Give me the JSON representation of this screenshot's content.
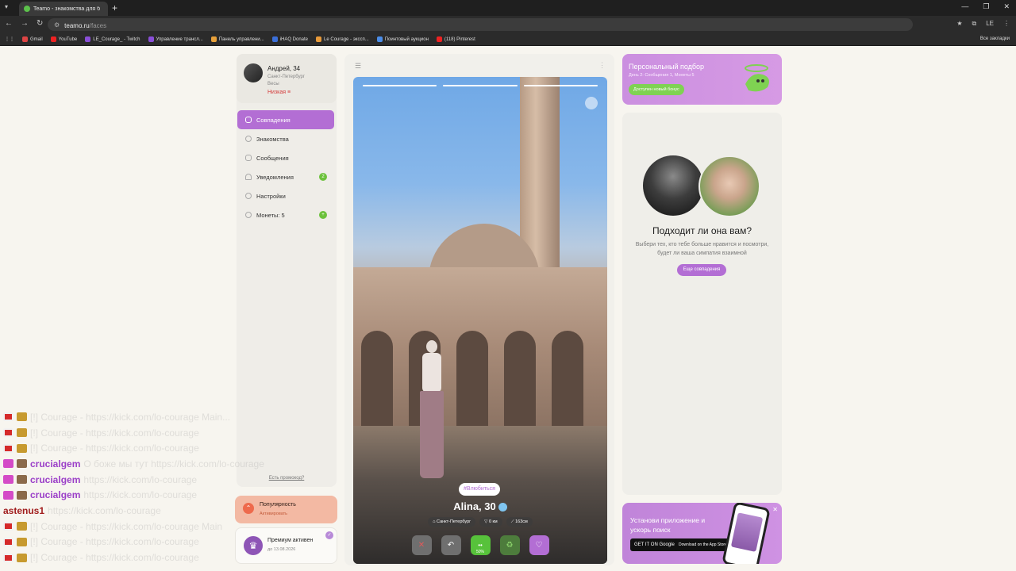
{
  "browser": {
    "tab_title": "Teamo - знакомства для брак...",
    "url_host": "teamo.ru",
    "url_path": "/faces",
    "profile_initials": "LE",
    "bookmarks": [
      "Gmail",
      "YouTube",
      "LE_Courage_ - Twitch",
      "Управление трансл...",
      "Панель управлени...",
      "iHAQ Donate",
      "Le Courage - экссп...",
      "Поинтовый аукцион",
      "(118) Pinterest"
    ],
    "all_bookmarks": "Все закладки"
  },
  "profile": {
    "name": "Андрей, 34",
    "city": "Санкт-Петербург",
    "zodiac": "Весы",
    "level": "Низкая ≡"
  },
  "menu": [
    {
      "label": "Совпадения",
      "icon": "matches-icon",
      "active": true
    },
    {
      "label": "Знакомства",
      "icon": "search-icon",
      "active": false
    },
    {
      "label": "Сообщения",
      "icon": "chat-icon",
      "active": false
    },
    {
      "label": "Уведомления",
      "icon": "bell-icon",
      "active": false,
      "badge": "2"
    },
    {
      "label": "Настройки",
      "icon": "gear-icon",
      "active": false
    },
    {
      "label": "Монеты: 5",
      "icon": "coin-icon",
      "active": false,
      "badge": "+"
    }
  ],
  "promo_link": "Есть промокод?",
  "popularity": {
    "title": "Популярность",
    "subtitle": "Активировать"
  },
  "premium": {
    "title": "Премиум активен",
    "subtitle": "до 13.08.2026"
  },
  "card": {
    "tag": "#Влюбиться",
    "name_age": "Alina, 30",
    "city": "Санкт-Петербург",
    "distance": "0 км",
    "height": "163см",
    "fire_percent": "50%"
  },
  "banner_top": {
    "title": "Персональный подбор",
    "subtitle": "День 2: Сообщения 1, Монеты 5",
    "button": "Доступен новый бонус"
  },
  "match": {
    "question": "Подходит ли она вам?",
    "description": "Выбери тех, кто тебе больше нравится и посмотри, будет ли ваша симпатия взаимной",
    "button": "Еще совпадения"
  },
  "banner_bottom": {
    "title": "Установи приложение и ускорь поиск",
    "google": "GET IT ON Google Play",
    "apple": "Download on the App Store"
  },
  "chat": [
    {
      "badges": [
        "red",
        "gold"
      ],
      "user": "",
      "color": "",
      "message": "[!] Courage - https://kick.com/lo-courage Main..."
    },
    {
      "badges": [
        "red",
        "gold"
      ],
      "user": "",
      "color": "",
      "message": "[!] Courage - https://kick.com/lo-courage"
    },
    {
      "badges": [
        "red",
        "gold"
      ],
      "user": "",
      "color": "",
      "message": "[!] Courage - https://kick.com/lo-courage"
    },
    {
      "badges": [
        "pink",
        "brown"
      ],
      "user": "crucialgem",
      "color": "#9b3fc8",
      "message": "О боже мы тут https://kick.com/lo-courage"
    },
    {
      "badges": [
        "pink",
        "brown"
      ],
      "user": "crucialgem",
      "color": "#9b3fc8",
      "message": "https://kick.com/lo-courage"
    },
    {
      "badges": [
        "pink",
        "brown"
      ],
      "user": "crucialgem",
      "color": "#9b3fc8",
      "message": "https://kick.com/lo-courage"
    },
    {
      "badges": [],
      "user": "astenus1",
      "color": "#a11d1d",
      "message": "https://kick.com/lo-courage"
    },
    {
      "badges": [
        "red",
        "gold"
      ],
      "user": "",
      "color": "",
      "message": "[!] Courage - https://kick.com/lo-courage Main"
    },
    {
      "badges": [
        "red",
        "gold"
      ],
      "user": "",
      "color": "",
      "message": "[!] Courage - https://kick.com/lo-courage"
    },
    {
      "badges": [
        "red",
        "gold"
      ],
      "user": "",
      "color": "",
      "message": "[!] Courage - https://kick.com/lo-courage"
    }
  ]
}
